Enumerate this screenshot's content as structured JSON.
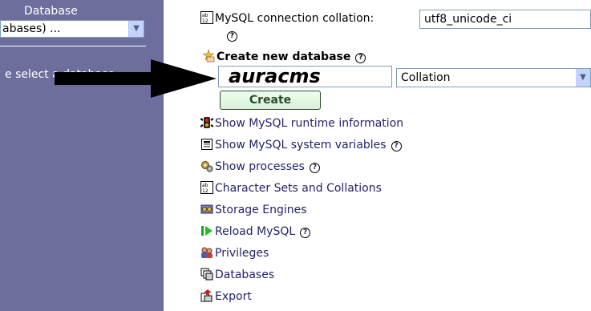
{
  "sidebar": {
    "label": "Database",
    "select_value": "abases) ...",
    "hint": "e select a database"
  },
  "main": {
    "collation_label": "MySQL connection collation:",
    "collation_value": "utf8_unicode_ci",
    "create_db_title": "Create new database",
    "db_name": "auracms",
    "collation_placeholder": "Collation",
    "create_button": "Create",
    "links": [
      {
        "label": "Show MySQL runtime information",
        "icon": "traffic-light-icon",
        "help": false
      },
      {
        "label": "Show MySQL system variables",
        "icon": "variables-icon",
        "help": true
      },
      {
        "label": "Show processes",
        "icon": "processes-icon",
        "help": true
      },
      {
        "label": "Character Sets and Collations",
        "icon": "charset-icon",
        "help": false
      },
      {
        "label": "Storage Engines",
        "icon": "engines-icon",
        "help": false
      },
      {
        "label": "Reload MySQL",
        "icon": "reload-icon",
        "help": true
      },
      {
        "label": "Privileges",
        "icon": "privileges-icon",
        "help": false
      },
      {
        "label": "Databases",
        "icon": "databases-icon",
        "help": false
      },
      {
        "label": "Export",
        "icon": "export-icon",
        "help": false
      }
    ]
  },
  "colors": {
    "sidebar_bg": "#6e6e9e",
    "link": "#232369",
    "button_border": "#2d4d2d"
  }
}
